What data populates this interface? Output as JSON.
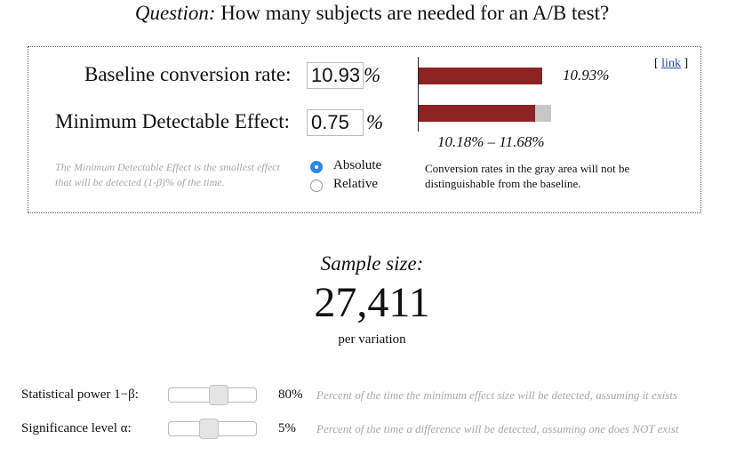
{
  "header": {
    "question_label": "Question:",
    "question_text": "How many subjects are needed for an A/B test?"
  },
  "inputs": {
    "baseline_label": "Baseline conversion rate:",
    "baseline_value": "10.93",
    "baseline_unit": "%",
    "mde_label": "Minimum Detectable Effect:",
    "mde_value": "0.75",
    "mde_unit": "%",
    "mde_note": "The Minimum Detectable Effect is the smallest effect that will be detected (1-β)% of the time."
  },
  "mode": {
    "options": [
      {
        "label": "Absolute",
        "selected": true
      },
      {
        "label": "Relative",
        "selected": false
      }
    ]
  },
  "visual": {
    "link_open": "[",
    "link_text": "link",
    "link_close": "]",
    "baseline_label": "10.93%",
    "range_label": "10.18% – 11.68%",
    "info": "Conversion rates in the gray area will not be distinguishable from the baseline.",
    "baseline_fraction": 0.1093,
    "range_low_fraction": 0.1018,
    "range_high_fraction": 0.1168,
    "colors": {
      "bar": "#8e2323",
      "gray_area": "#c7c7c7",
      "radio_on": "#2f86e8"
    }
  },
  "result": {
    "title": "Sample size:",
    "value": "27,411",
    "per": "per variation"
  },
  "sliders": [
    {
      "label": "Statistical power 1−β:",
      "value": "80%",
      "desc": "Percent of the time the minimum effect size will be detected, assuming it exists",
      "level": 0.8
    },
    {
      "label": "Significance level α:",
      "value": "5%",
      "desc": "Percent of the time a difference will be detected, assuming one does NOT exist",
      "level": 0.05
    }
  ]
}
